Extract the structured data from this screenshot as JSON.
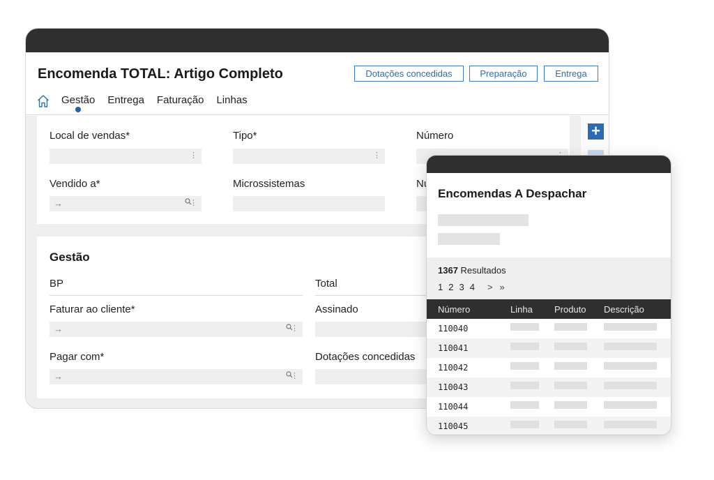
{
  "main_window": {
    "title": "Encomenda TOTAL: Artigo Completo",
    "actions": [
      {
        "label": "Dotações concedidas"
      },
      {
        "label": "Preparação"
      },
      {
        "label": "Entrega"
      }
    ],
    "tabs": [
      {
        "label": "Gestão",
        "active": true
      },
      {
        "label": "Entrega"
      },
      {
        "label": "Faturação"
      },
      {
        "label": "Linhas"
      }
    ],
    "card1": {
      "fields": [
        {
          "label": "Local de vendas*"
        },
        {
          "label": "Tipo*"
        },
        {
          "label": "Número"
        },
        {
          "label": "Vendido a*"
        },
        {
          "label": "Microssistemas"
        },
        {
          "label": "Nu"
        }
      ]
    },
    "card2": {
      "section_title": "Gestão",
      "left_fields": [
        {
          "label": "BP"
        },
        {
          "label": "Faturar ao cliente*"
        },
        {
          "label": "Pagar com*"
        }
      ],
      "right_fields": [
        {
          "label": "Total"
        },
        {
          "label": "Assinado"
        },
        {
          "label": "Dotações concedidas"
        }
      ]
    },
    "plus_label": "+"
  },
  "popup": {
    "title": "Encomendas A Despachar",
    "results_count": "1367",
    "results_label": " Resultados",
    "pages": [
      "1",
      "2",
      "3",
      "4"
    ],
    "next_label": ">",
    "last_label": "»",
    "columns": [
      "Número",
      "Linha",
      "Produto",
      "Descrição"
    ],
    "rows": [
      "110040",
      "110041",
      "110042",
      "110043",
      "110044",
      "110045"
    ]
  },
  "colors": {
    "accent": "#2f6db3",
    "titlebar": "#2f2f2f",
    "panel_bg": "#efefef"
  }
}
